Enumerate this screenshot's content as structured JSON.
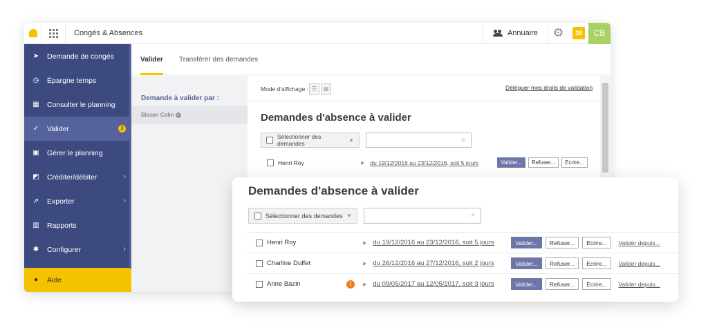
{
  "topbar": {
    "app_title": "Congés & Absences",
    "annuaire_label": "Annuaire",
    "count_badge": "38",
    "avatar_initials": "CB"
  },
  "sidebar": {
    "items": [
      {
        "label": "Demande de congés",
        "icon": "paper-plane-icon"
      },
      {
        "label": "Épargne temps",
        "icon": "clock-icon"
      },
      {
        "label": "Consulter le planning",
        "icon": "calendar-icon"
      },
      {
        "label": "Valider",
        "icon": "check-icon",
        "badge": "3",
        "active": true
      },
      {
        "label": "Gérer le planning",
        "icon": "planning-edit-icon"
      },
      {
        "label": "Créditer/débiter",
        "icon": "edit-square-icon"
      },
      {
        "label": "Exporter",
        "icon": "export-icon"
      },
      {
        "label": "Rapports",
        "icon": "bar-chart-icon"
      },
      {
        "label": "Configurer",
        "icon": "gear-icon"
      }
    ],
    "help_label": "Aide"
  },
  "tabs": [
    {
      "label": "Valider",
      "active": true
    },
    {
      "label": "Transférer des demandes",
      "active": false
    }
  ],
  "sub_panel": {
    "title": "Demande à valider par :",
    "person": "Bisson Colin"
  },
  "content": {
    "mode_label": "Mode d'affichage :",
    "delegate_link": "Déléguer mes droits de validation",
    "heading": "Demandes d'absence à valider",
    "select_label": "Sélectionner des demandes",
    "rows": [
      {
        "name": "Henri Roy",
        "period": "du 19/12/2016 au 23/12/2016, soit 5 jours"
      }
    ],
    "buttons": {
      "validate": "Valider...",
      "refuse": "Refuser...",
      "write": "Ecrire..."
    }
  },
  "front": {
    "heading": "Demandes d'absence à valider",
    "select_label": "Sélectionner des demandes",
    "rows": [
      {
        "name": "Henri Roy",
        "warning": false,
        "period": "du 19/12/2016 au 23/12/2016, soit 5 jours"
      },
      {
        "name": "Charline Duffet",
        "warning": false,
        "period": "du 26/12/2016 au 27/12/2016, soit 2 jours"
      },
      {
        "name": "Anne Bazin",
        "warning": true,
        "period": "du 09/05/2017 au 12/05/2017, soit 3 jours"
      }
    ],
    "buttons": {
      "validate": "Valider...",
      "refuse": "Refuser...",
      "write": "Ecrire...",
      "validate_since": "Valider depuis..."
    }
  },
  "colors": {
    "accent": "#f5c200",
    "sidebar": "#3d4a80",
    "primary_button": "#6d76a8",
    "avatar": "#a8d064",
    "warning": "#f07a1a"
  }
}
